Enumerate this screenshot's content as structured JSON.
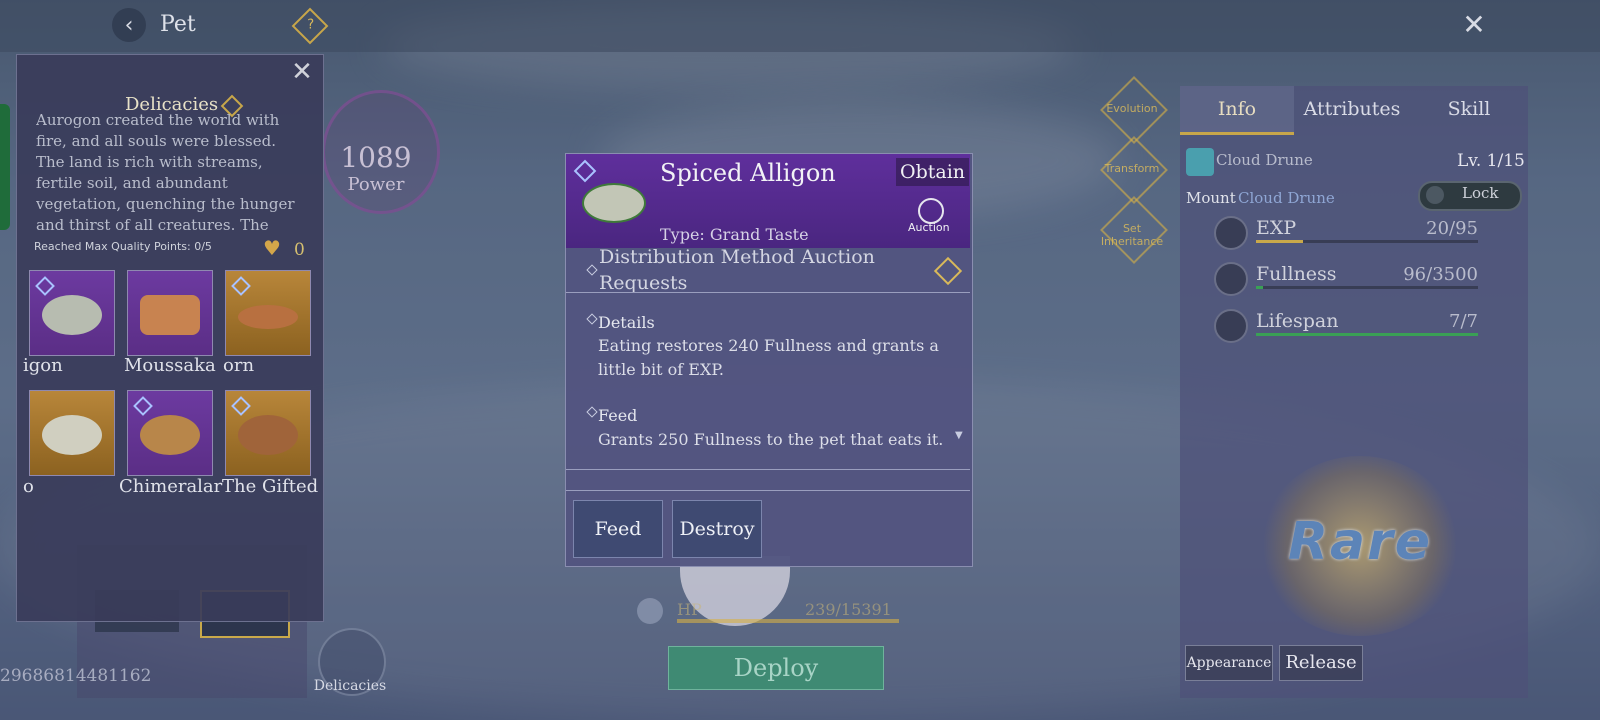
{
  "topbar": {
    "title": "Pet",
    "back_icon": "chevron-left-icon",
    "help_icon": "question-icon",
    "close_icon": "close-icon"
  },
  "background": {
    "power_value": "1089",
    "power_label": "Power",
    "pet_id": "29686814481162",
    "delicacies_button_label": "Delicacies",
    "hp_label": "HP",
    "hp_value": "239/15391",
    "deploy_label": "Deploy",
    "right_action_labels": [
      "Evolution",
      "Transform",
      "Set Inheritance"
    ]
  },
  "delicacies_panel": {
    "title": "Delicacies",
    "description": "Aurogon created the world with fire, and all souls were blessed. The land is rich with streams, fertile soil, and abundant vegetation, quenching the hunger and thirst of all creatures. The delicate fragrance of nature and",
    "quality_text": "Reached Max Quality Points: 0/5",
    "quality_count": "0",
    "items": [
      {
        "name": "igon",
        "color": "purple"
      },
      {
        "name": "Moussaka",
        "color": "purple"
      },
      {
        "name": "orn",
        "color": "gold"
      },
      {
        "name": "o",
        "color": "gold"
      },
      {
        "name": "Chimeralar",
        "color": "purple"
      },
      {
        "name": "The Gifted",
        "color": "gold"
      }
    ]
  },
  "tooltip": {
    "item_name": "Spiced Alligon",
    "obtain_label": "Obtain",
    "auction_label": "Auction",
    "type_text": "Type: Grand Taste",
    "distribution_text": "Distribution Method    Auction Requests",
    "details_title": "Details",
    "details_text": "Eating restores 240 Fullness and grants a little bit of EXP.",
    "feed_title": "Feed",
    "feed_text": "Grants 250 Fullness to the pet that eats it.",
    "feed_button": "Feed",
    "destroy_button": "Destroy"
  },
  "info_panel": {
    "tabs": [
      "Info",
      "Attributes",
      "Skill"
    ],
    "active_tab": "Info",
    "pet_name": "Cloud Drune",
    "level": "Lv. 1/15",
    "mount_label": "Mount",
    "mount_name": "Cloud Drune",
    "lock_label": "Lock",
    "stats": [
      {
        "name": "EXP",
        "value": "20/95",
        "fill": 0.21,
        "color": "#c9a94a"
      },
      {
        "name": "Fullness",
        "value": "96/3500",
        "fill": 0.03,
        "color": "#3aa055"
      },
      {
        "name": "Lifespan",
        "value": "7/7",
        "fill": 1.0,
        "color": "#3aa055"
      }
    ],
    "rarity": "Rare",
    "appearance_button": "Appearance",
    "release_button": "Release"
  },
  "colors": {
    "accent_gold": "#c7a64a",
    "rare_blue": "#5c84b8",
    "tooltip_purple": "#5f2f9c"
  }
}
